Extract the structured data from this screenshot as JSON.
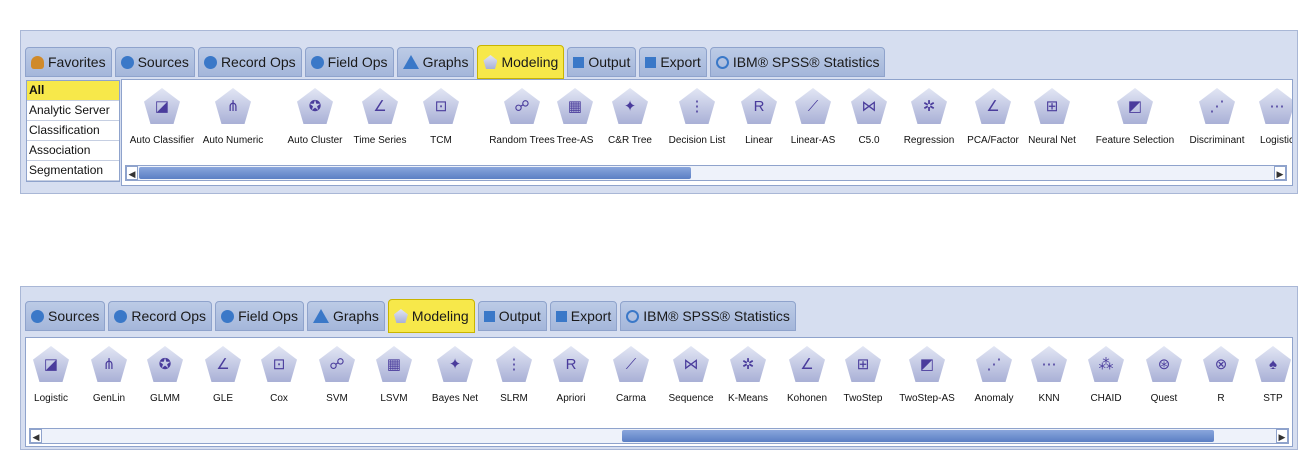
{
  "palette1": {
    "tabs": [
      {
        "label": "Favorites",
        "icon": "person"
      },
      {
        "label": "Sources",
        "icon": "circle"
      },
      {
        "label": "Record Ops",
        "icon": "circle"
      },
      {
        "label": "Field Ops",
        "icon": "circle"
      },
      {
        "label": "Graphs",
        "icon": "tri"
      },
      {
        "label": "Modeling",
        "icon": "pent",
        "active": true
      },
      {
        "label": "Output",
        "icon": "sq"
      },
      {
        "label": "Export",
        "icon": "sq"
      },
      {
        "label": "IBM® SPSS® Statistics",
        "icon": "ring"
      }
    ],
    "sidebar": [
      {
        "label": "All",
        "active": true
      },
      {
        "label": "Analytic Server"
      },
      {
        "label": "Classification"
      },
      {
        "label": "Association"
      },
      {
        "label": "Segmentation"
      }
    ],
    "nodes": [
      "Auto Classifier",
      "Auto Numeric",
      "Auto Cluster",
      "Time Series",
      "TCM",
      "Random Trees",
      "Tree-AS",
      "C&R Tree",
      "Decision List",
      "Linear",
      "Linear-AS",
      "C5.0",
      "Regression",
      "PCA/Factor",
      "Neural Net",
      "Feature Selection",
      "Discriminant",
      "Logistic"
    ],
    "scroll_left": "◀",
    "scroll_right": "▶"
  },
  "palette2": {
    "tabs": [
      {
        "label": "Sources",
        "icon": "circle"
      },
      {
        "label": "Record Ops",
        "icon": "circle"
      },
      {
        "label": "Field Ops",
        "icon": "circle"
      },
      {
        "label": "Graphs",
        "icon": "tri"
      },
      {
        "label": "Modeling",
        "icon": "pent",
        "active": true
      },
      {
        "label": "Output",
        "icon": "sq"
      },
      {
        "label": "Export",
        "icon": "sq"
      },
      {
        "label": "IBM® SPSS® Statistics",
        "icon": "ring"
      }
    ],
    "nodes": [
      "Logistic",
      "GenLin",
      "GLMM",
      "GLE",
      "Cox",
      "SVM",
      "LSVM",
      "Bayes Net",
      "SLRM",
      "Apriori",
      "Carma",
      "Sequence",
      "K-Means",
      "Kohonen",
      "TwoStep",
      "TwoStep-AS",
      "Anomaly",
      "KNN",
      "CHAID",
      "Quest",
      "R",
      "STP"
    ],
    "scroll_left": "◀",
    "scroll_right": "▶"
  }
}
